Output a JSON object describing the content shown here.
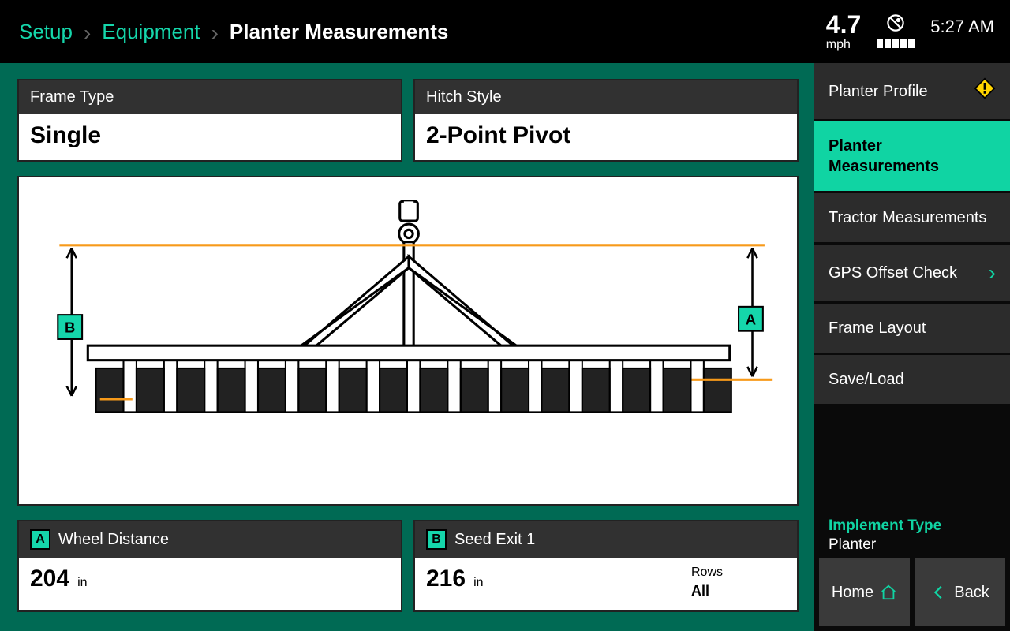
{
  "breadcrumb": {
    "root": "Setup",
    "mid": "Equipment",
    "current": "Planter Measurements"
  },
  "status": {
    "speed": "4.7",
    "speed_unit": "mph",
    "time": "5:27 AM"
  },
  "cards": {
    "frame_type": {
      "label": "Frame Type",
      "value": "Single"
    },
    "hitch_style": {
      "label": "Hitch Style",
      "value": "2-Point Pivot"
    }
  },
  "measures": {
    "a": {
      "badge": "A",
      "label": "Wheel Distance",
      "value": "204",
      "unit": "in"
    },
    "b": {
      "badge": "B",
      "label": "Seed Exit 1",
      "value": "216",
      "unit": "in",
      "rows_label": "Rows",
      "rows_value": "All"
    }
  },
  "diagram": {
    "badge_a": "A",
    "badge_b": "B"
  },
  "sidebar": {
    "items": [
      {
        "label": "Planter Profile",
        "warn": true
      },
      {
        "label": "Planter Measurements",
        "active": true
      },
      {
        "label": "Tractor Measurements"
      },
      {
        "label": "GPS Offset Check",
        "chevron": true
      },
      {
        "label": "Frame Layout"
      },
      {
        "label": "Save/Load"
      }
    ],
    "implement": {
      "label": "Implement Type",
      "value": "Planter"
    },
    "home": "Home",
    "back": "Back"
  }
}
